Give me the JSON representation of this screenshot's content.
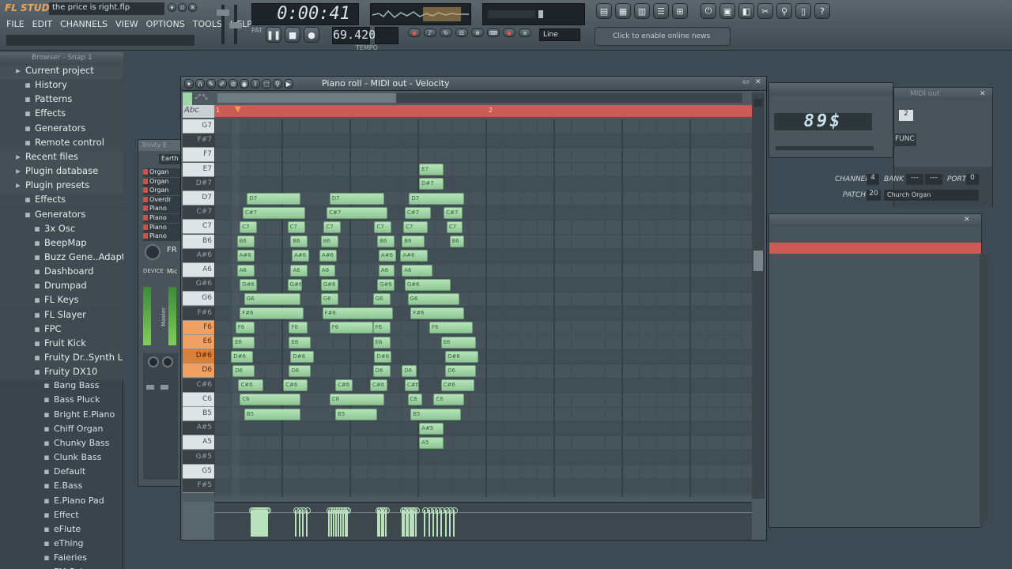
{
  "app": {
    "logo": "FL STUDIO",
    "project_title": "the price is right.flp"
  },
  "menu": [
    "FILE",
    "EDIT",
    "CHANNELS",
    "VIEW",
    "OPTIONS",
    "TOOLS",
    "HELP"
  ],
  "transport": {
    "time": "0:00:41",
    "tempo": "69.420",
    "tempo_label": "TEMPO",
    "pat_label": "PAT",
    "song_label": "SONG",
    "snap_mode": "Line"
  },
  "news": {
    "text": "Click to enable online news"
  },
  "browser": {
    "header": "Browser - Snap 1",
    "items": [
      {
        "label": "Current project",
        "kind": "top",
        "indent": 0
      },
      {
        "label": "History",
        "kind": "folder",
        "indent": 1
      },
      {
        "label": "Patterns",
        "kind": "folder",
        "indent": 1
      },
      {
        "label": "Effects",
        "kind": "folder",
        "indent": 1
      },
      {
        "label": "Generators",
        "kind": "folder",
        "indent": 1
      },
      {
        "label": "Remote control",
        "kind": "folder",
        "indent": 1
      },
      {
        "label": "Recent files",
        "kind": "top",
        "indent": 0
      },
      {
        "label": "Plugin database",
        "kind": "top",
        "indent": 0
      },
      {
        "label": "Plugin presets",
        "kind": "top",
        "indent": 0
      },
      {
        "label": "Effects",
        "kind": "folder",
        "indent": 1
      },
      {
        "label": "Generators",
        "kind": "folder",
        "indent": 1
      },
      {
        "label": "3x Osc",
        "kind": "folder",
        "indent": 2
      },
      {
        "label": "BeepMap",
        "kind": "folder",
        "indent": 2
      },
      {
        "label": "Buzz Gene..Adapter",
        "kind": "folder",
        "indent": 2
      },
      {
        "label": "Dashboard",
        "kind": "folder",
        "indent": 2
      },
      {
        "label": "Drumpad",
        "kind": "folder",
        "indent": 2
      },
      {
        "label": "FL Keys",
        "kind": "folder",
        "indent": 2
      },
      {
        "label": "FL Slayer",
        "kind": "folder",
        "indent": 2
      },
      {
        "label": "FPC",
        "kind": "folder",
        "indent": 2
      },
      {
        "label": "Fruit Kick",
        "kind": "folder",
        "indent": 2
      },
      {
        "label": "Fruity Dr..Synth Live",
        "kind": "folder",
        "indent": 2
      },
      {
        "label": "Fruity DX10",
        "kind": "folder",
        "indent": 2
      },
      {
        "label": "Bang Bass",
        "kind": "file",
        "indent": 3
      },
      {
        "label": "Bass Pluck",
        "kind": "file",
        "indent": 3
      },
      {
        "label": "Bright E.Piano",
        "kind": "file",
        "indent": 3
      },
      {
        "label": "Chiff Organ",
        "kind": "file",
        "indent": 3
      },
      {
        "label": "Chunky Bass",
        "kind": "file",
        "indent": 3
      },
      {
        "label": "Clunk Bass",
        "kind": "file",
        "indent": 3
      },
      {
        "label": "Default",
        "kind": "file",
        "indent": 3
      },
      {
        "label": "E.Bass",
        "kind": "file",
        "indent": 3
      },
      {
        "label": "E.Piano Pad",
        "kind": "file",
        "indent": 3
      },
      {
        "label": "Effect",
        "kind": "file",
        "indent": 3
      },
      {
        "label": "eFlute",
        "kind": "file",
        "indent": 3
      },
      {
        "label": "eThing",
        "kind": "file",
        "indent": 3
      },
      {
        "label": "Faieries",
        "kind": "file",
        "indent": 3
      },
      {
        "label": "FM Sub",
        "kind": "file",
        "indent": 3
      }
    ]
  },
  "channel_window": {
    "title": "Trinity E",
    "tab": "Earth",
    "rows": [
      "Organ",
      "Organ",
      "Organ",
      "Overdr",
      "Piano",
      "Piano",
      "Piano",
      "Piano"
    ],
    "fr_label": "FR",
    "device_label": "DEVICE",
    "mic_label": "Mic",
    "master_label": "Master"
  },
  "midi_out": {
    "title": "MIDI out",
    "display": "89$",
    "func_label": "FUNC",
    "channel_label": "CHANNEL",
    "channel_value": "4",
    "bank_label": "BANK",
    "bank_value1": "---",
    "bank_value2": "---",
    "port_label": "PORT",
    "port_value": "0",
    "patch_label": "PATCH",
    "patch_value": "20",
    "patch_name": "Church Organ",
    "box_value": "2"
  },
  "piano_roll": {
    "title": "Piano roll - MIDI out - Velocity",
    "ruler_marks": [
      "1",
      "2"
    ],
    "keyboard_label": "Abc",
    "keys": [
      {
        "n": "G7",
        "t": "w"
      },
      {
        "n": "F#7",
        "t": "b"
      },
      {
        "n": "F7",
        "t": "w"
      },
      {
        "n": "E7",
        "t": "w"
      },
      {
        "n": "D#7",
        "t": "b"
      },
      {
        "n": "D7",
        "t": "w"
      },
      {
        "n": "C#7",
        "t": "b"
      },
      {
        "n": "C7",
        "t": "w"
      },
      {
        "n": "B6",
        "t": "w"
      },
      {
        "n": "A#6",
        "t": "b"
      },
      {
        "n": "A6",
        "t": "w"
      },
      {
        "n": "G#6",
        "t": "b"
      },
      {
        "n": "G6",
        "t": "w"
      },
      {
        "n": "F#6",
        "t": "b"
      },
      {
        "n": "F6",
        "t": "w",
        "hl": true
      },
      {
        "n": "E6",
        "t": "w",
        "hl": true
      },
      {
        "n": "D#6",
        "t": "b",
        "hl": true
      },
      {
        "n": "D6",
        "t": "w",
        "hl": true
      },
      {
        "n": "C#6",
        "t": "b"
      },
      {
        "n": "C6",
        "t": "w"
      },
      {
        "n": "B5",
        "t": "w"
      },
      {
        "n": "A#5",
        "t": "b"
      },
      {
        "n": "A5",
        "t": "w"
      },
      {
        "n": "G#5",
        "t": "b"
      },
      {
        "n": "G5",
        "t": "w"
      },
      {
        "n": "F#5",
        "t": "b"
      }
    ],
    "notes": [
      {
        "p": "D7",
        "s": 1.05,
        "l": 1.85
      },
      {
        "p": "C#7",
        "s": 0.9,
        "l": 2.15
      },
      {
        "p": "C7",
        "s": 0.8,
        "l": 0.6
      },
      {
        "p": "C7",
        "s": 2.45,
        "l": 0.6
      },
      {
        "p": "B6",
        "s": 0.7,
        "l": 0.6
      },
      {
        "p": "B6",
        "s": 2.55,
        "l": 0.6
      },
      {
        "p": "A#6",
        "s": 0.7,
        "l": 0.6
      },
      {
        "p": "A#6",
        "s": 2.6,
        "l": 0.6
      },
      {
        "p": "A6",
        "s": 0.7,
        "l": 0.6
      },
      {
        "p": "A6",
        "s": 2.55,
        "l": 0.6
      },
      {
        "p": "G#6",
        "s": 0.8,
        "l": 0.6
      },
      {
        "p": "G#6",
        "s": 2.45,
        "l": 0.5
      },
      {
        "p": "G6",
        "s": 0.95,
        "l": 1.95
      },
      {
        "p": "F#6",
        "s": 0.8,
        "l": 2.2
      },
      {
        "p": "F6",
        "s": 0.65,
        "l": 0.65
      },
      {
        "p": "F6",
        "s": 2.5,
        "l": 0.65
      },
      {
        "p": "E6",
        "s": 0.55,
        "l": 0.75
      },
      {
        "p": "E6",
        "s": 2.5,
        "l": 0.75
      },
      {
        "p": "D#6",
        "s": 0.5,
        "l": 0.75
      },
      {
        "p": "D#6",
        "s": 2.55,
        "l": 0.8
      },
      {
        "p": "D6",
        "s": 0.55,
        "l": 0.75
      },
      {
        "p": "D6",
        "s": 2.5,
        "l": 0.75
      },
      {
        "p": "C#6",
        "s": 0.75,
        "l": 0.85
      },
      {
        "p": "C#6",
        "s": 2.3,
        "l": 0.85
      },
      {
        "p": "C6",
        "s": 0.8,
        "l": 2.1
      },
      {
        "p": "B5",
        "s": 0.95,
        "l": 1.95
      },
      {
        "p": "D7",
        "s": 3.9,
        "l": 1.9
      },
      {
        "p": "C#7",
        "s": 3.8,
        "l": 2.1
      },
      {
        "p": "C7",
        "s": 3.7,
        "l": 0.6
      },
      {
        "p": "C7",
        "s": 5.45,
        "l": 0.6
      },
      {
        "p": "B6",
        "s": 3.6,
        "l": 0.6
      },
      {
        "p": "B6",
        "s": 5.55,
        "l": 0.6
      },
      {
        "p": "A#6",
        "s": 3.55,
        "l": 0.6
      },
      {
        "p": "A#6",
        "s": 5.6,
        "l": 0.6
      },
      {
        "p": "A6",
        "s": 3.55,
        "l": 0.55
      },
      {
        "p": "A6",
        "s": 5.6,
        "l": 0.55
      },
      {
        "p": "G#6",
        "s": 3.6,
        "l": 0.6
      },
      {
        "p": "G#6",
        "s": 5.55,
        "l": 0.6
      },
      {
        "p": "G6",
        "s": 3.6,
        "l": 0.6
      },
      {
        "p": "G6",
        "s": 5.4,
        "l": 0.6
      },
      {
        "p": "F#6",
        "s": 3.65,
        "l": 2.45
      },
      {
        "p": "F6",
        "s": 3.9,
        "l": 1.5
      },
      {
        "p": "F6",
        "s": 5.4,
        "l": 0.6
      },
      {
        "p": "E6",
        "s": 5.4,
        "l": 0.6
      },
      {
        "p": "D#6",
        "s": 5.45,
        "l": 0.6
      },
      {
        "p": "D6",
        "s": 5.4,
        "l": 0.6
      },
      {
        "p": "C#6",
        "s": 4.1,
        "l": 0.6
      },
      {
        "p": "C#6",
        "s": 5.3,
        "l": 0.6
      },
      {
        "p": "C6",
        "s": 3.9,
        "l": 1.9
      },
      {
        "p": "B5",
        "s": 4.1,
        "l": 1.45
      },
      {
        "p": "E7",
        "s": 7.0,
        "l": 0.85
      },
      {
        "p": "D#7",
        "s": 7.0,
        "l": 0.85
      },
      {
        "p": "D7",
        "s": 6.65,
        "l": 1.9
      },
      {
        "p": "C#7",
        "s": 6.5,
        "l": 0.9
      },
      {
        "p": "C#7",
        "s": 7.85,
        "l": 0.65
      },
      {
        "p": "C7",
        "s": 6.45,
        "l": 0.85
      },
      {
        "p": "C7",
        "s": 7.95,
        "l": 0.55
      },
      {
        "p": "B6",
        "s": 6.4,
        "l": 0.8
      },
      {
        "p": "B6",
        "s": 8.05,
        "l": 0.5
      },
      {
        "p": "A#6",
        "s": 6.35,
        "l": 0.95
      },
      {
        "p": "A6",
        "s": 6.4,
        "l": 1.05
      },
      {
        "p": "G#6",
        "s": 6.5,
        "l": 1.6
      },
      {
        "p": "G6",
        "s": 6.6,
        "l": 1.8
      },
      {
        "p": "F#6",
        "s": 6.7,
        "l": 1.85
      },
      {
        "p": "F6",
        "s": 7.35,
        "l": 1.5
      },
      {
        "p": "E6",
        "s": 7.75,
        "l": 1.2
      },
      {
        "p": "D#6",
        "s": 7.9,
        "l": 1.15
      },
      {
        "p": "D6",
        "s": 6.4,
        "l": 0.5
      },
      {
        "p": "D6",
        "s": 7.9,
        "l": 1.05
      },
      {
        "p": "C#6",
        "s": 6.5,
        "l": 0.5
      },
      {
        "p": "C#6",
        "s": 7.75,
        "l": 1.15
      },
      {
        "p": "C6",
        "s": 6.6,
        "l": 0.5
      },
      {
        "p": "C6",
        "s": 7.5,
        "l": 1.05
      },
      {
        "p": "B5",
        "s": 6.7,
        "l": 1.75
      },
      {
        "p": "A#5",
        "s": 7.0,
        "l": 0.85
      },
      {
        "p": "A5",
        "s": 7.0,
        "l": 0.85
      }
    ],
    "velocity_groups": [
      [
        0.35,
        0.85,
        11
      ],
      [
        1.8,
        2.15,
        4
      ],
      [
        2.9,
        3.5,
        9
      ],
      [
        4.5,
        4.75,
        5
      ],
      [
        5.3,
        5.75,
        8
      ],
      [
        6.05,
        7.0,
        8
      ]
    ]
  }
}
